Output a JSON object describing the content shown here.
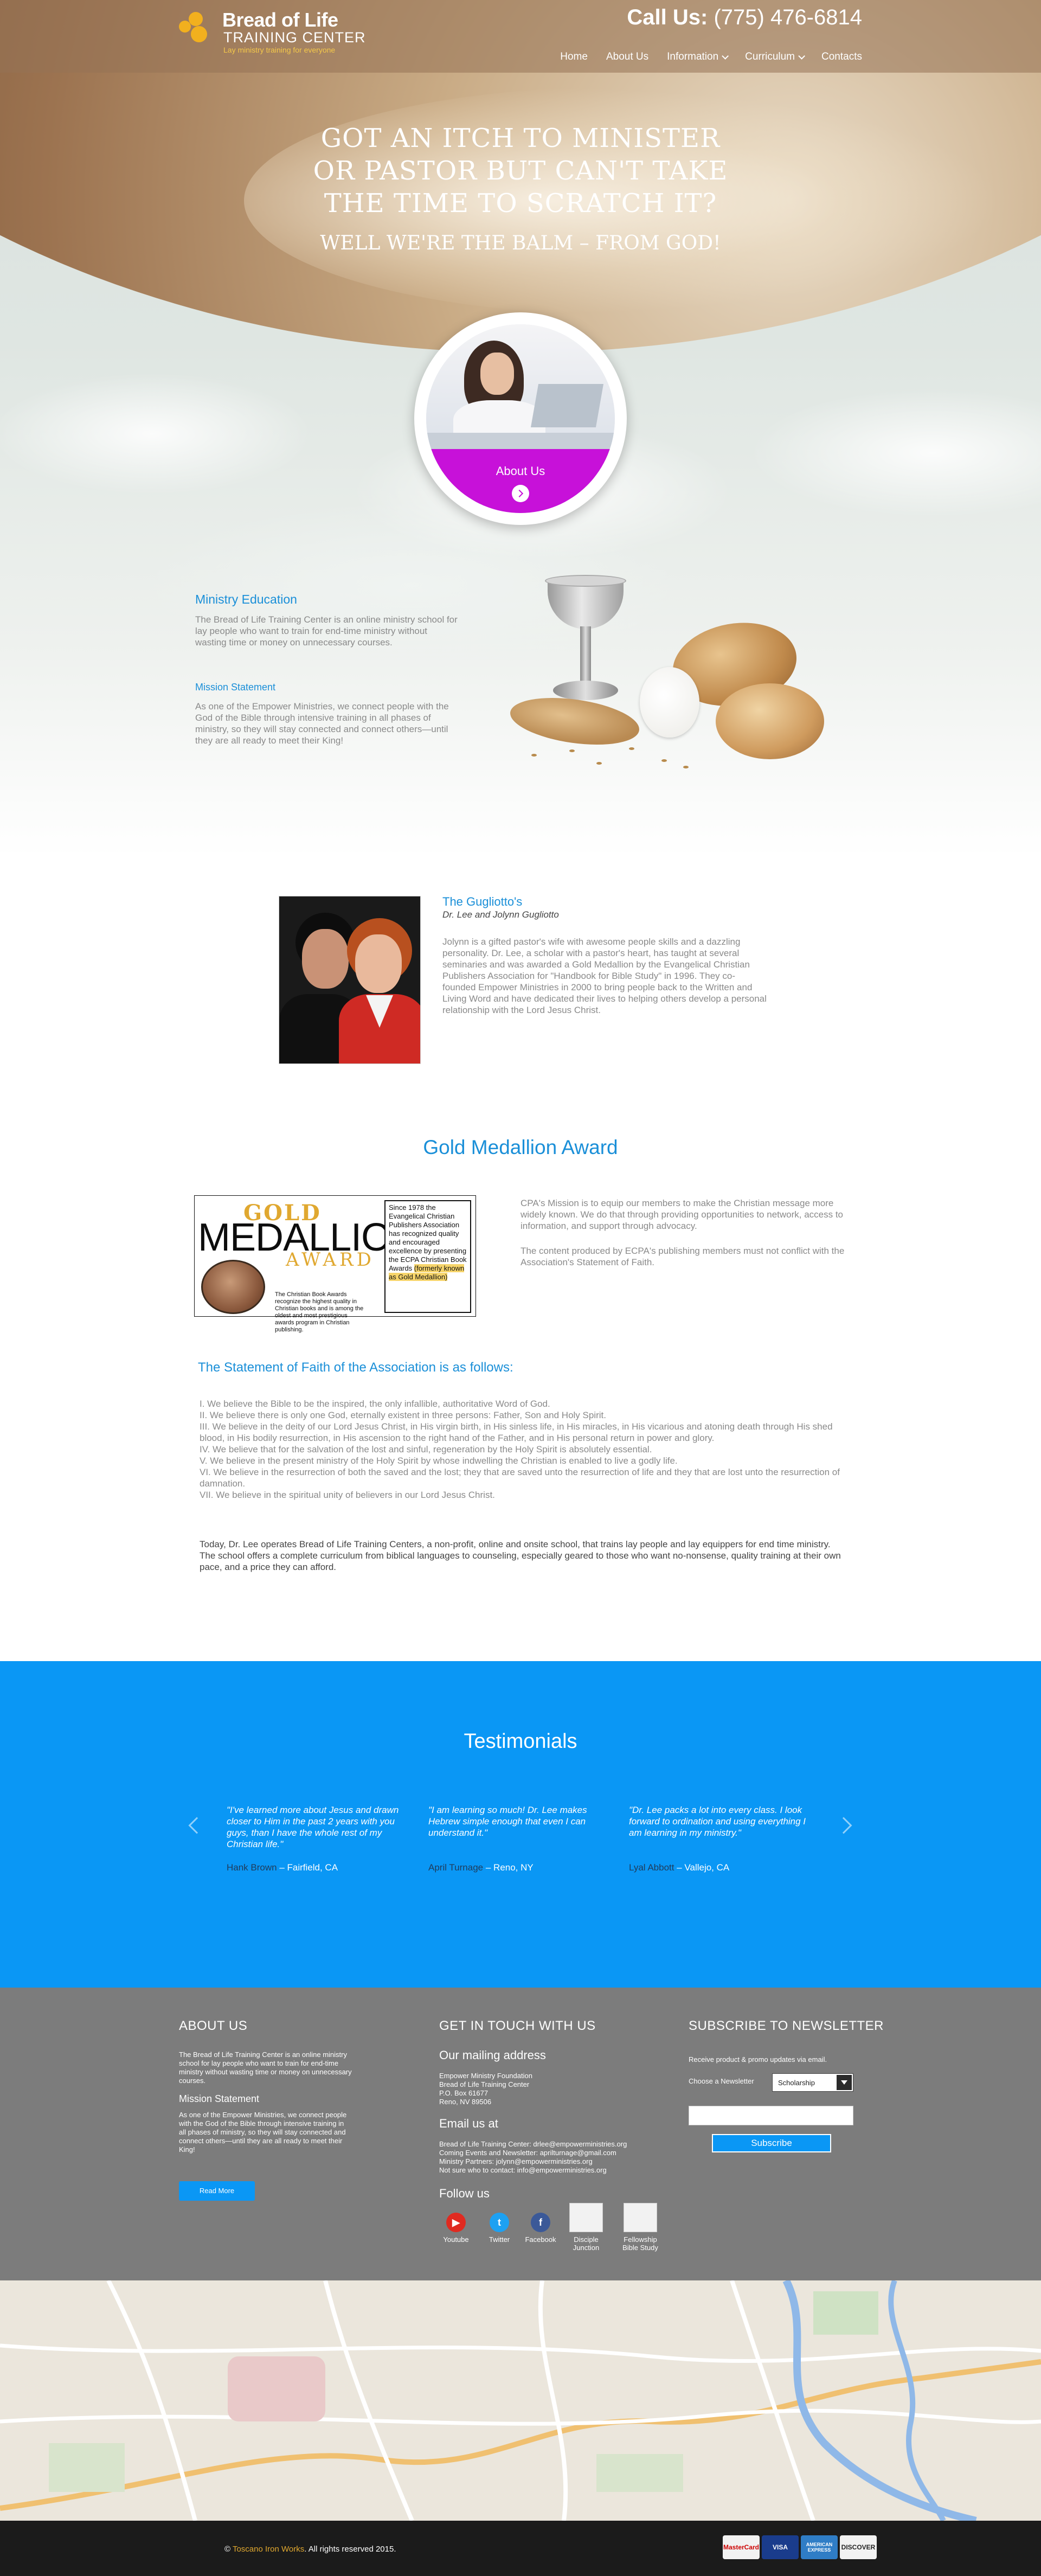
{
  "brand": {
    "title": "Bread of Life",
    "subtitle": "TRAINING CENTER",
    "tagline": "Lay ministry training for everyone"
  },
  "header": {
    "call_label": "Call Us:",
    "phone": "(775) 476-6814",
    "nav": [
      "Home",
      "About Us",
      "Information",
      "Curriculum",
      "Contacts"
    ]
  },
  "hero": {
    "headline": [
      "GOT AN ITCH TO MINISTER",
      "OR PASTOR BUT CAN'T TAKE",
      "THE TIME TO SCRATCH IT?"
    ],
    "tagline": "WELL WE'RE THE BALM – FROM GOD!"
  },
  "about_circle": {
    "label": "About Us"
  },
  "ministry": {
    "heading": "Ministry Education",
    "text": "The Bread of Life Training Center is an online ministry school for lay people who want to train for end-time ministry without wasting time or money on unnecessary courses.",
    "mission_heading": "Mission Statement",
    "mission_text": "As one of the Empower Ministries, we connect people with the God of the Bible through intensive training in all phases of ministry, so they will stay connected and connect others—until they are all ready to meet their King!"
  },
  "guigliotto": {
    "title": "The Gugliotto's",
    "subtitle": "Dr. Lee and Jolynn Gugliotto",
    "text": "Jolynn is a gifted pastor's wife with awesome people skills and a dazzling personality. Dr. Lee, a scholar with a pastor's heart, has taught at several seminaries and was awarded a Gold Medallion by the Evangelical Christian Publishers Association for \"Handbook for Bible Study\" in 1996. They co-founded Empower Ministries in 2000 to bring people back to the Written and Living Word and have dedicated their lives to helping others develop a personal relationship with the Lord Jesus Christ."
  },
  "gold_medallion": {
    "title": "Gold Medallion Award",
    "award": {
      "gold": "GOLD",
      "medallion": "MEDALLION",
      "word": "AWARD",
      "caption": "The Christian Book Awards recognize the highest quality in Christian books and is among the oldest and most prestigious awards program in Christian publishing.",
      "box_text": "Since 1978 the Evangelical Christian Publishers Association has recognized quality and encouraged excellence by presenting the ECPA Christian Book Awards",
      "box_highlight": "(formerly known as Gold Medallion)"
    },
    "cpa_p1": "CPA's Mission is to equip our members to make the Christian message more widely known. We do that through providing opportunities to network, access to information, and support through advocacy.",
    "cpa_p2": "The content produced by ECPA's publishing members must not conflict with the Association's Statement of Faith."
  },
  "statement_of_faith": {
    "heading": "The Statement of Faith of the Association is as follows:",
    "items": [
      "I. We believe the Bible to be the inspired, the only infallible, authoritative Word of God.",
      "II. We believe there is only one God, eternally existent in three persons: Father, Son and Holy Spirit.",
      "III. We believe in the deity of our Lord Jesus Christ, in His virgin birth, in His sinless life, in His miracles, in His vicarious and atoning death through His shed blood, in His bodily resurrection, in His ascension to the right hand of the Father, and in His personal return in power and glory.",
      "IV. We believe that for the salvation of the lost and sinful, regeneration by the Holy Spirit is absolutely essential.",
      "V. We believe in the present ministry of the Holy Spirit by whose indwelling the Christian is enabled to live a godly life.",
      "VI. We believe in the resurrection of both the saved and the lost; they that are saved unto the resurrection of life and they that are lost unto the resurrection of damnation.",
      "VII. We believe in the spiritual unity of believers in our Lord Jesus Christ."
    ],
    "today": "Today, Dr. Lee operates Bread of Life Training Centers, a non-profit, online and onsite school, that trains lay people and lay equippers for end time ministry. The school offers a complete curriculum from biblical languages to counseling, especially geared to those who want no-nonsense, quality training at their own pace, and a price they can afford."
  },
  "testimonials": {
    "title": "Testimonials",
    "items": [
      {
        "quote": "\"I've learned more about Jesus and drawn closer to Him in the past 2 years with you guys, than I have the whole rest of my Christian life.\"",
        "name": "Hank Brown",
        "place": "– Fairfield, CA"
      },
      {
        "quote": "\"I am learning so much! Dr. Lee makes Hebrew simple enough that even I can understand it.\"",
        "name": "April Turnage",
        "place": "– Reno, NY"
      },
      {
        "quote": "\"Dr. Lee packs a lot into every class. I look forward to ordination and using everything I am learning in my ministry.\"",
        "name": "Lyal Abbott",
        "place": "– Vallejo, CA"
      }
    ]
  },
  "footer": {
    "about": {
      "heading": "ABOUT US",
      "text": "The Bread of Life Training Center is an online ministry school for lay people who want to train for end-time ministry without wasting time or money on unnecessary courses.",
      "mission_heading": "Mission Statement",
      "mission_text": "As one of the Empower Ministries, we connect people with the God of the Bible through intensive training in all phases of ministry, so they will stay connected and connect others—until they are all ready to meet their King!",
      "read_more": "Read More"
    },
    "contact": {
      "heading": "GET IN TOUCH WITH US",
      "mailing_heading": "Our mailing address",
      "mailing_lines": [
        "Empower Ministry Foundation",
        "Bread of Life Training Center",
        "P.O. Box 61677",
        "Reno, NV 89506"
      ],
      "email_heading": "Email us at",
      "email_lines": [
        "Bread of Life Training Center: drlee@empowerministries.org",
        "Coming Events and Newsletter: aprilturnage@gmail.com",
        "Ministry Partners: jolynn@empowerministries.org",
        "Not sure who to contact: info@empowerministries.org"
      ],
      "follow_heading": "Follow us",
      "social": [
        {
          "label": "Youtube",
          "icon": "youtube-icon",
          "color": "#e02a20"
        },
        {
          "label": "Twitter",
          "icon": "twitter-icon",
          "color": "#1da1f2"
        },
        {
          "label": "Facebook",
          "icon": "facebook-icon",
          "color": "#3b5998"
        },
        {
          "label": "Disciple Junction",
          "icon": "disciple-junction-icon"
        },
        {
          "label": "Fellowship Bible Study",
          "icon": "fellowship-bible-study-icon"
        }
      ]
    },
    "newsletter": {
      "heading": "SUBSCRIBE TO NEWSLETTER",
      "intro": "Receive product & promo updates via email.",
      "choose_label": "Choose a Newsletter",
      "selected": "Scholarship",
      "email_placeholder": "",
      "button": "Subscribe"
    }
  },
  "bottom": {
    "brand": "Toscano Iron Works",
    "rights": ". All rights reserved 2015.",
    "cards": [
      "MasterCard",
      "VISA",
      "AMERICAN EXPRESS",
      "DISCOVER"
    ]
  },
  "colors": {
    "accent": "#1a8fd8",
    "testimonial_bg": "#0a97f5",
    "footer_bg": "#7c7c7c",
    "about_band": "#c711d9",
    "gold": "#e0a830"
  }
}
